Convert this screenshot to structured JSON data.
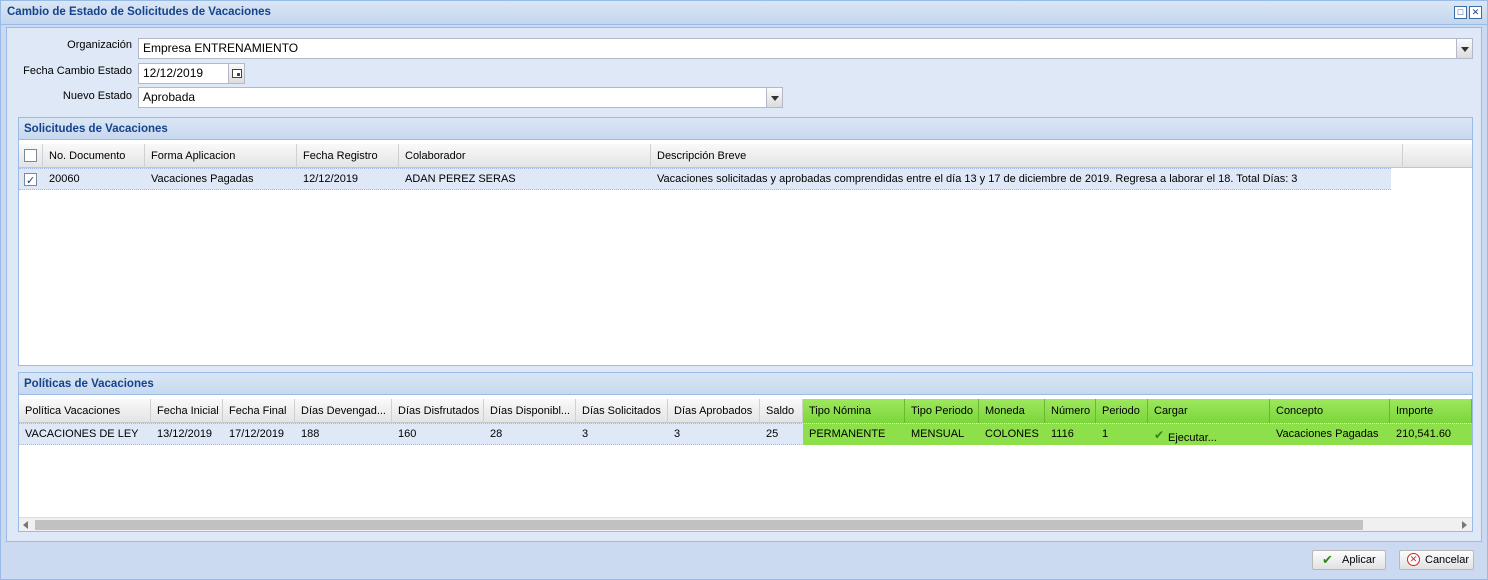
{
  "window": {
    "title": "Cambio de Estado de Solicitudes de Vacaciones"
  },
  "form": {
    "organizacion_label": "Organización",
    "organizacion_value": "Empresa ENTRENAMIENTO",
    "fecha_label": "Fecha Cambio Estado",
    "fecha_value": "12/12/2019",
    "estado_label": "Nuevo Estado",
    "estado_value": "Aprobada"
  },
  "solicitudes": {
    "title": "Solicitudes de Vacaciones",
    "columns": [
      "No. Documento",
      "Forma Aplicacion",
      "Fecha Registro",
      "Colaborador",
      "Descripción Breve"
    ],
    "rows": [
      {
        "checked": true,
        "documento": "20060",
        "forma": "Vacaciones Pagadas",
        "fecha": "12/12/2019",
        "colaborador": "ADAN PEREZ SERAS",
        "descripcion": "Vacaciones solicitadas y aprobadas comprendidas entre el día 13 y 17 de diciembre de 2019. Regresa a laborar el 18. Total Días: 3"
      }
    ]
  },
  "politicas": {
    "title": "Políticas de Vacaciones",
    "columns": [
      "Política Vacaciones",
      "Fecha Inicial",
      "Fecha Final",
      "Días Devengad...",
      "Días Disfrutados",
      "Días Disponibl...",
      "Días Solicitados",
      "Días Aprobados",
      "Saldo",
      "Tipo Nómina",
      "Tipo Periodo",
      "Moneda",
      "Número",
      "Periodo",
      "Cargar",
      "Concepto",
      "Importe"
    ],
    "row": {
      "politica": "VACACIONES DE LEY",
      "fecha_inicial": "13/12/2019",
      "fecha_final": "17/12/2019",
      "devengados": "188",
      "disfrutados": "160",
      "disponibles": "28",
      "solicitados": "3",
      "aprobados": "3",
      "saldo": "25",
      "tipo_nomina": "PERMANENTE",
      "tipo_periodo": "MENSUAL",
      "moneda": "COLONES",
      "numero": "1116",
      "periodo": "1",
      "cargar": "Ejecutar...",
      "concepto": "Vacaciones Pagadas",
      "importe": "210,541.60"
    },
    "highlight_color": "#8ee04a"
  },
  "buttons": {
    "aplicar": "Aplicar",
    "cancelar": "Cancelar"
  },
  "colors": {
    "title_text": "#15428b",
    "panel_border": "#99bbe8",
    "selected_row": "#dfe8f6"
  }
}
